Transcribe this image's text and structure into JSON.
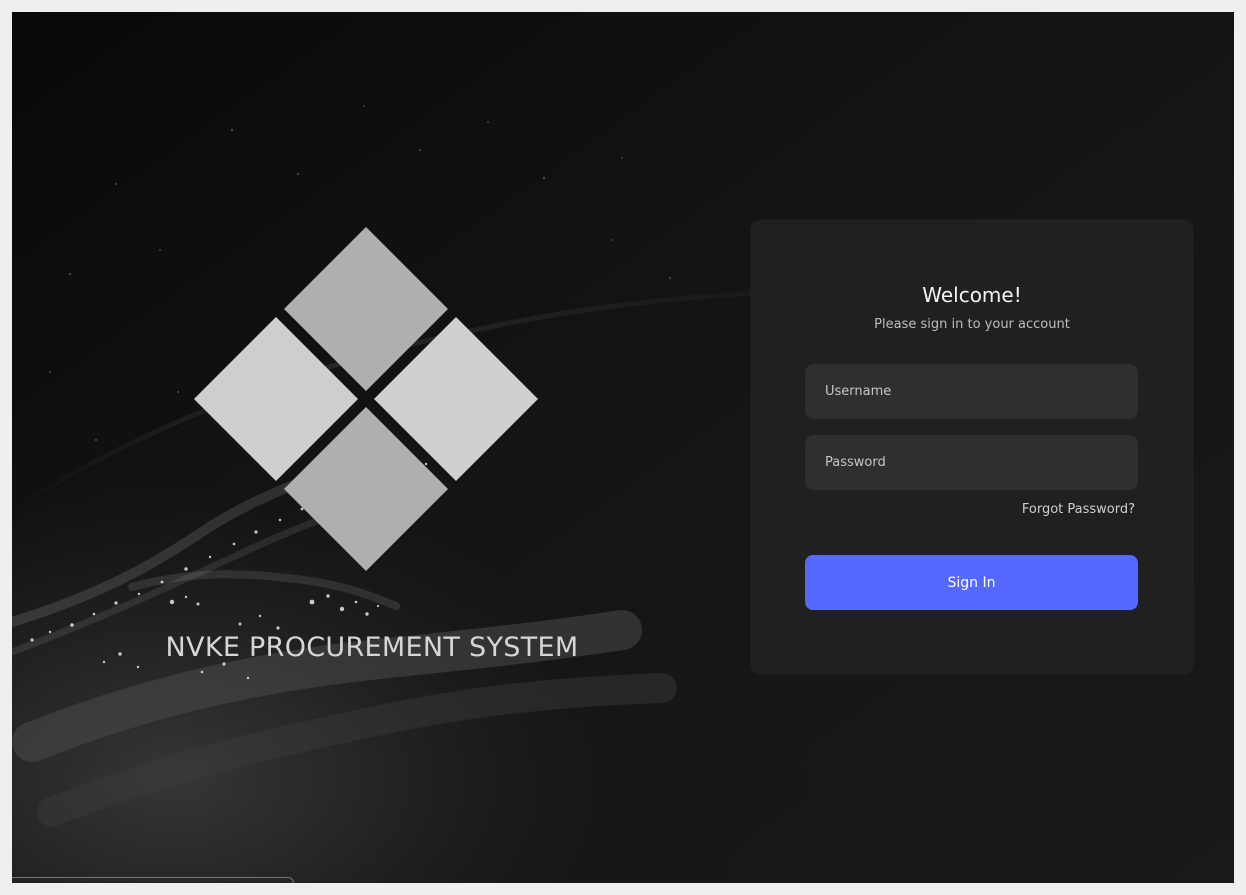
{
  "hero": {
    "brand": "NVKE PROCUREMENT SYSTEM",
    "logo_icon": "diamond-grid-logo-icon"
  },
  "login": {
    "title": "Welcome!",
    "subtitle": "Please sign in to your account",
    "username_placeholder": "Username",
    "password_placeholder": "Password",
    "forgot_password": "Forgot Password?",
    "sign_in": "Sign In"
  },
  "colors": {
    "background": "#151515",
    "card": "#202020",
    "field": "#2f2f2f",
    "primary_button": "#5568ff",
    "logo_light": "#cfcfcf",
    "logo_mid": "#afafaf"
  }
}
